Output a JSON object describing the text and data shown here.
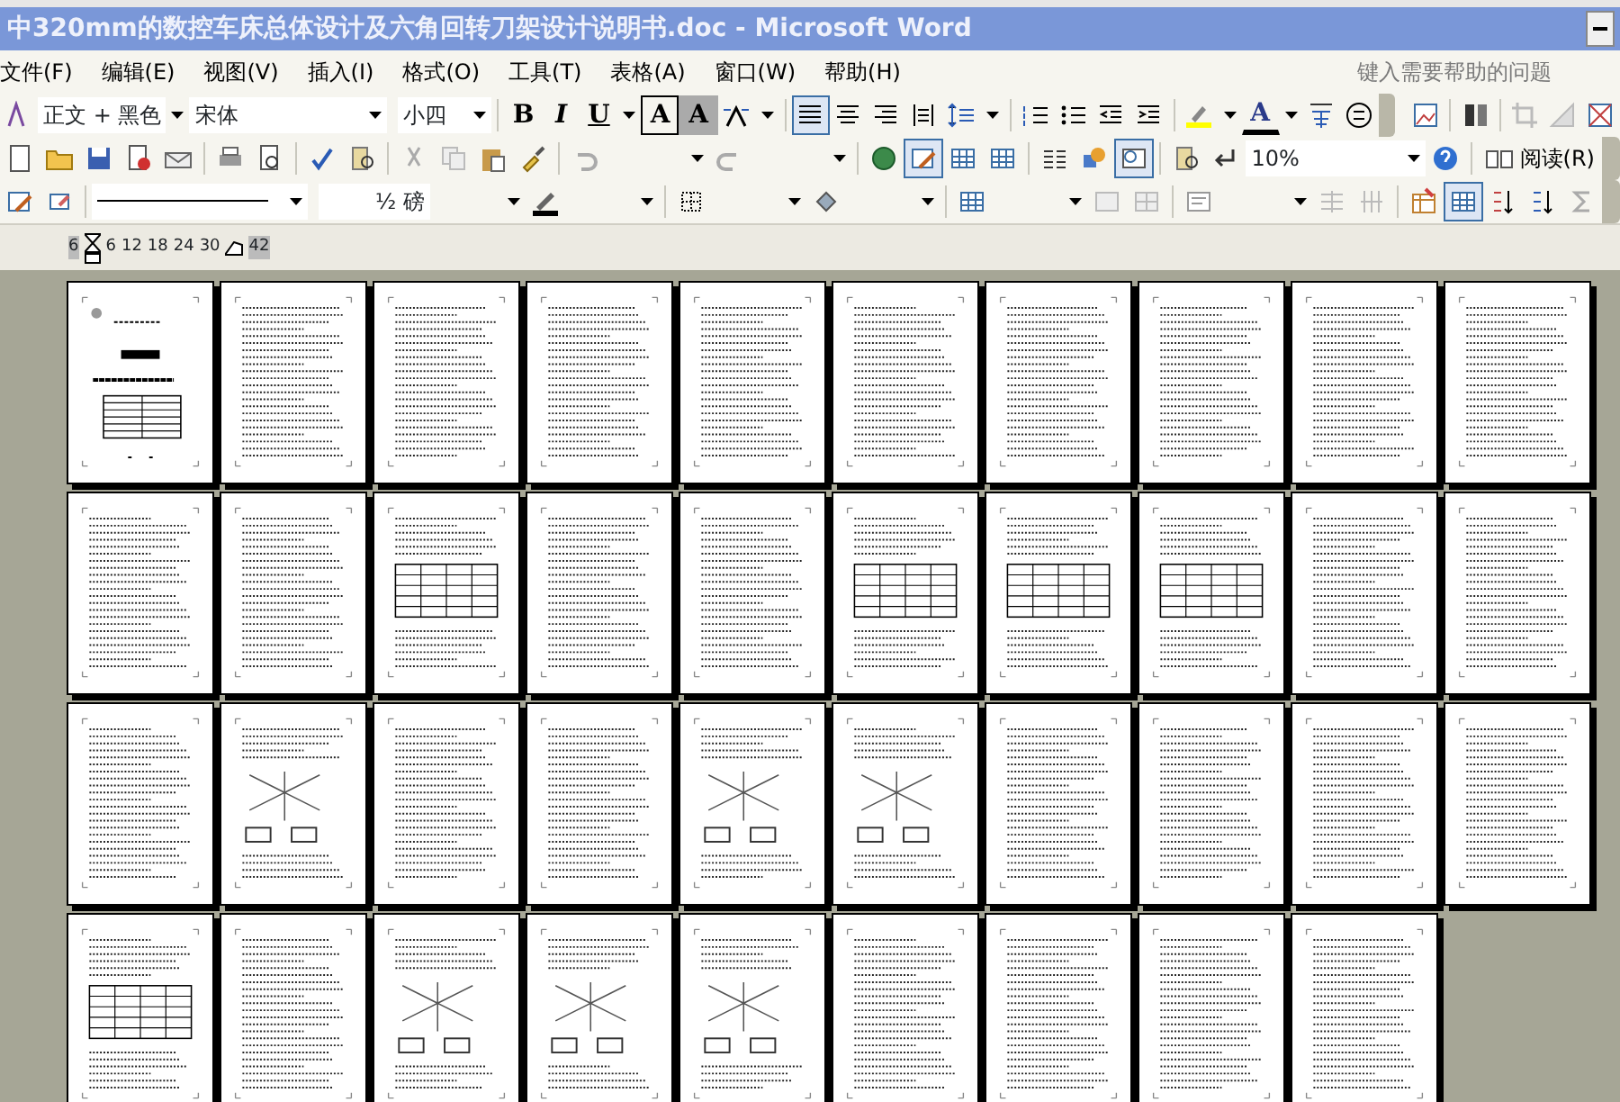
{
  "window": {
    "title": "中320mm的数控车床总体设计及六角回转刀架设计说明书.doc - Microsoft Word"
  },
  "menu": [
    {
      "label": "文件(F)"
    },
    {
      "label": "编辑(E)"
    },
    {
      "label": "视图(V)"
    },
    {
      "label": "插入(I)"
    },
    {
      "label": "格式(O)"
    },
    {
      "label": "工具(T)"
    },
    {
      "label": "表格(A)"
    },
    {
      "label": "窗口(W)"
    },
    {
      "label": "帮助(H)"
    }
  ],
  "help_box": {
    "placeholder": "键入需要帮助的问题"
  },
  "formatting_toolbar": {
    "style": "正文 + 黑色",
    "font": "宋体",
    "size": "小四",
    "buttons": [
      {
        "label": "B",
        "kind": "bold"
      },
      {
        "label": "I",
        "kind": "italic"
      },
      {
        "label": "U",
        "kind": "underline"
      },
      {
        "label": "A",
        "kind": "border"
      },
      {
        "label": "A",
        "kind": "shade"
      }
    ],
    "font_color": "A"
  },
  "standard_toolbar": {
    "zoom": "10%",
    "read_button": "阅读(R)"
  },
  "tables_toolbar": {
    "line_weight": "½ 磅"
  },
  "ruler": {
    "labels": [
      "6",
      "6",
      "12",
      "18",
      "24",
      "30",
      "42"
    ]
  },
  "pages": [
    {
      "kind": "cover"
    },
    {
      "kind": "text"
    },
    {
      "kind": "text"
    },
    {
      "kind": "text"
    },
    {
      "kind": "text"
    },
    {
      "kind": "text"
    },
    {
      "kind": "text"
    },
    {
      "kind": "text"
    },
    {
      "kind": "text"
    },
    {
      "kind": "text"
    },
    {
      "kind": "text"
    },
    {
      "kind": "text"
    },
    {
      "kind": "table"
    },
    {
      "kind": "text"
    },
    {
      "kind": "text"
    },
    {
      "kind": "table"
    },
    {
      "kind": "table"
    },
    {
      "kind": "table"
    },
    {
      "kind": "text"
    },
    {
      "kind": "text"
    },
    {
      "kind": "text"
    },
    {
      "kind": "figure"
    },
    {
      "kind": "text"
    },
    {
      "kind": "text"
    },
    {
      "kind": "figure"
    },
    {
      "kind": "figure"
    },
    {
      "kind": "text"
    },
    {
      "kind": "text"
    },
    {
      "kind": "text"
    },
    {
      "kind": "text"
    },
    {
      "kind": "table"
    },
    {
      "kind": "text"
    },
    {
      "kind": "figure"
    },
    {
      "kind": "figure"
    },
    {
      "kind": "figure"
    },
    {
      "kind": "text"
    },
    {
      "kind": "text"
    },
    {
      "kind": "text"
    },
    {
      "kind": "text"
    }
  ]
}
